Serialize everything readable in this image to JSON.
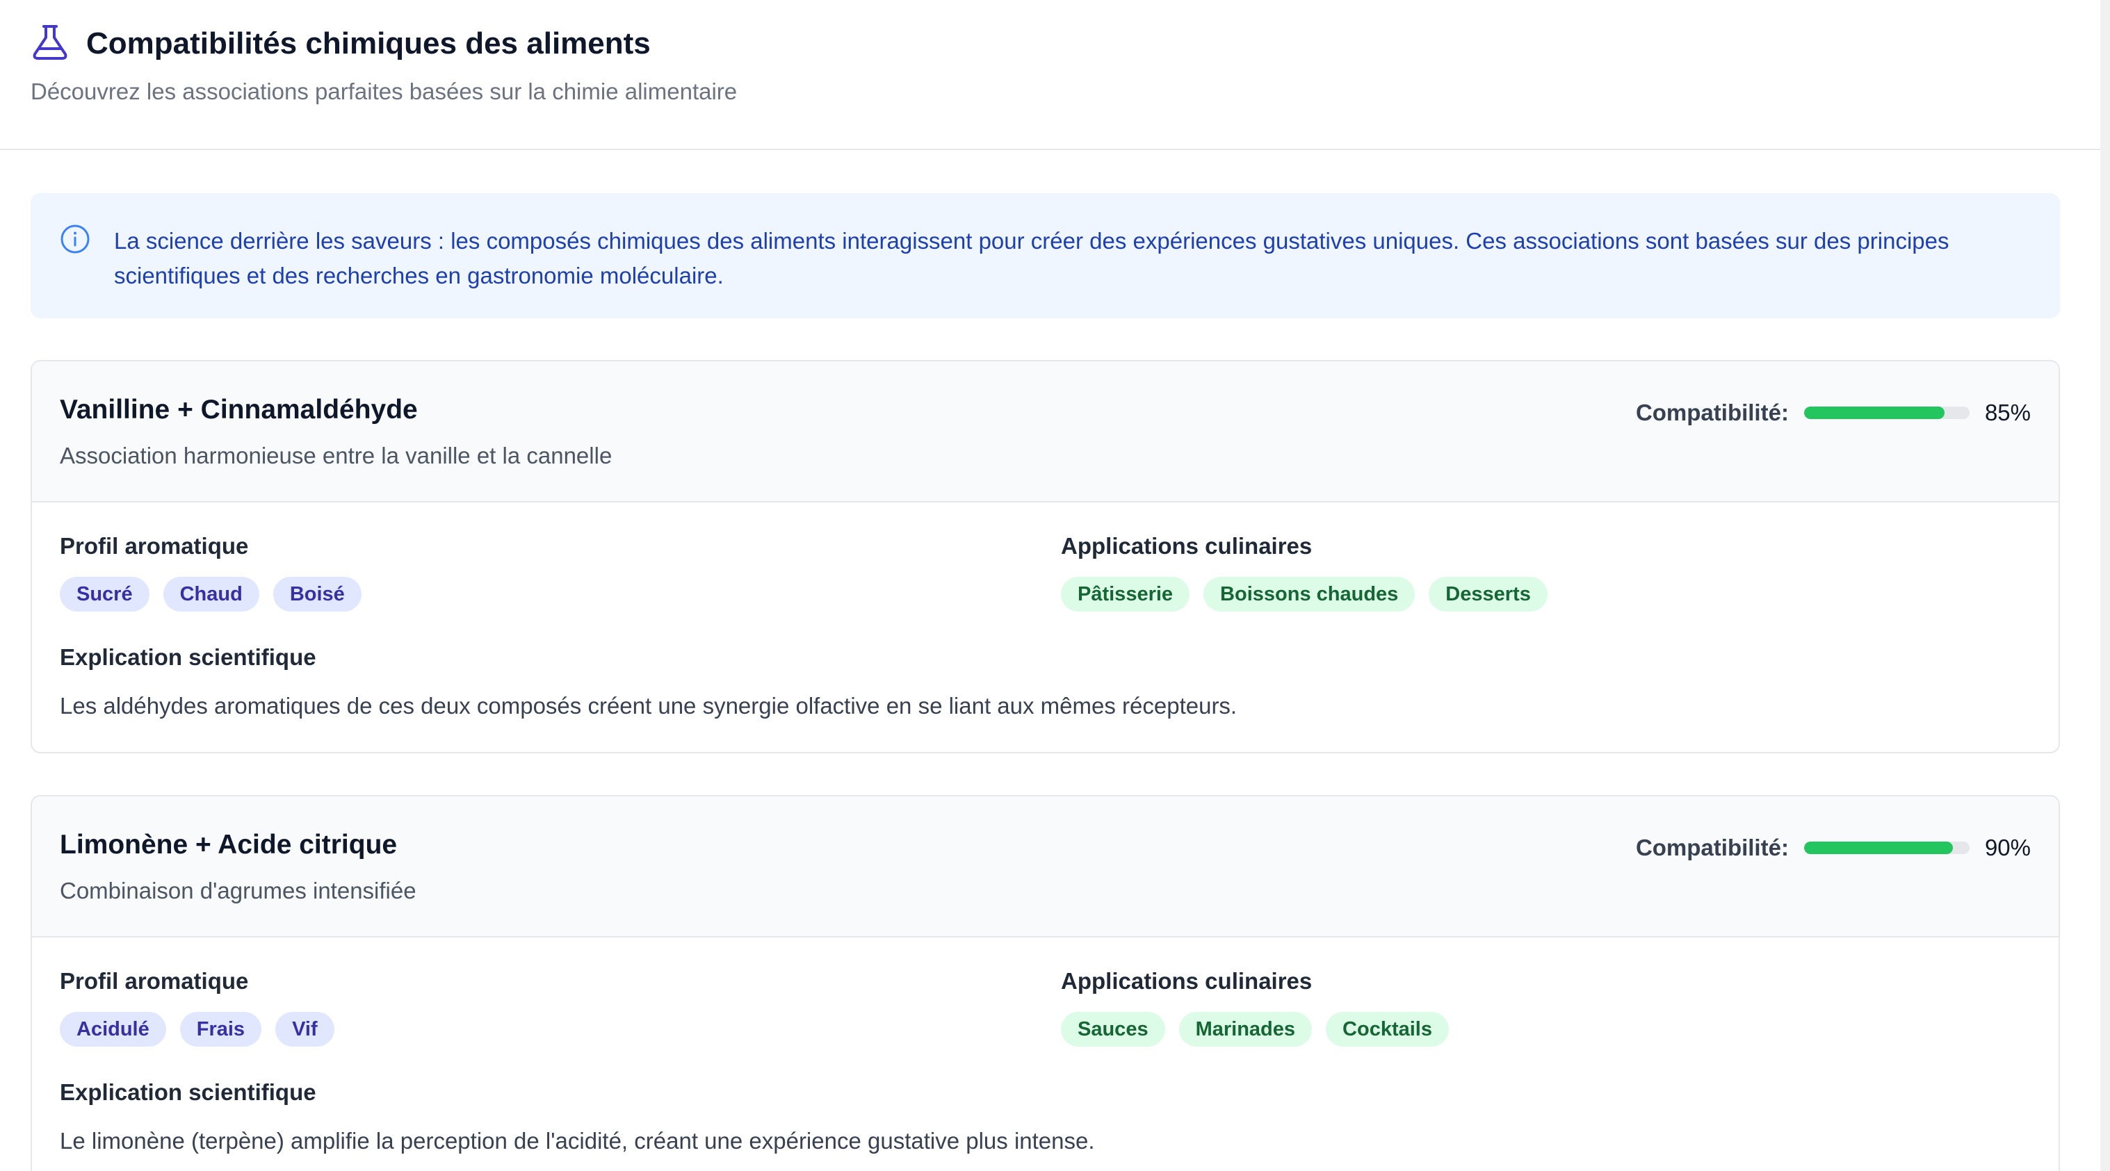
{
  "header": {
    "title": "Compatibilités chimiques des aliments",
    "subtitle": "Découvrez les associations parfaites basées sur la chimie alimentaire",
    "icon": "flask-icon"
  },
  "info": {
    "icon": "info-icon",
    "text": "La science derrière les saveurs : les composés chimiques des aliments interagissent pour créer des expériences gustatives uniques. Ces associations sont basées sur des principes scientifiques et des recherches en gastronomie moléculaire."
  },
  "colors": {
    "accent": "#4338ca",
    "progress": "#22c55e",
    "info_text": "#1e40af"
  },
  "cards": [
    {
      "title": "Vanilline + Cinnamaldéhyde",
      "description": "Association harmonieuse entre la vanille et la cannelle",
      "compat_label": "Compatibilité:",
      "compat_percent": 85,
      "compat_value": "85%",
      "profile_label": "Profil aromatique",
      "profile_tags": [
        "Sucré",
        "Chaud",
        "Boisé"
      ],
      "apps_label": "Applications culinaires",
      "app_tags": [
        "Pâtisserie",
        "Boissons chaudes",
        "Desserts"
      ],
      "explain_label": "Explication scientifique",
      "explain_text": "Les aldéhydes aromatiques de ces deux composés créent une synergie olfactive en se liant aux mêmes récepteurs."
    },
    {
      "title": "Limonène + Acide citrique",
      "description": "Combinaison d'agrumes intensifiée",
      "compat_label": "Compatibilité:",
      "compat_percent": 90,
      "compat_value": "90%",
      "profile_label": "Profil aromatique",
      "profile_tags": [
        "Acidulé",
        "Frais",
        "Vif"
      ],
      "apps_label": "Applications culinaires",
      "app_tags": [
        "Sauces",
        "Marinades",
        "Cocktails"
      ],
      "explain_label": "Explication scientifique",
      "explain_text": "Le limonène (terpène) amplifie la perception de l'acidité, créant une expérience gustative plus intense."
    }
  ]
}
